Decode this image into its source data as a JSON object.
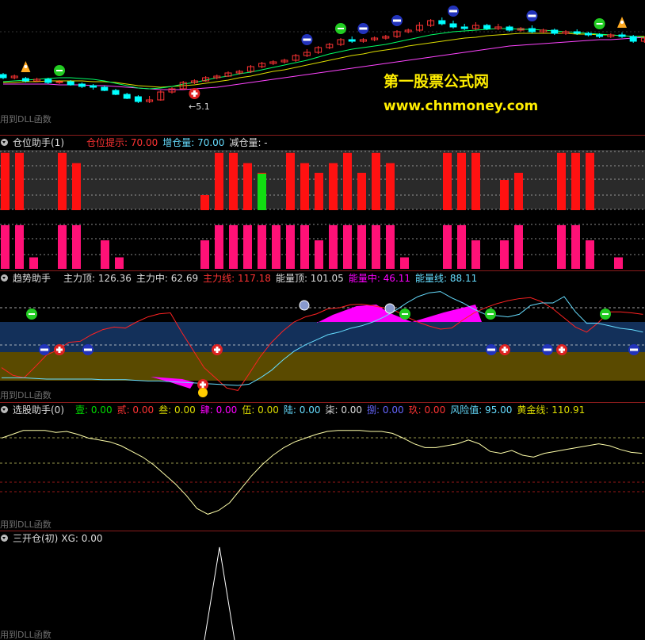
{
  "watermark": {
    "title": "第一股票公式网",
    "url": "www.chnmoney.com"
  },
  "main_panel": {
    "dll_note": "用到DLL函数",
    "low_label": "←5.1",
    "candles": [
      {
        "o": 94,
        "c": 98,
        "h": 92,
        "l": 100
      },
      {
        "o": 98,
        "c": 96,
        "h": 94,
        "l": 100
      },
      {
        "o": 99,
        "c": 102,
        "h": 97,
        "l": 104
      },
      {
        "o": 102,
        "c": 100,
        "h": 98,
        "l": 103
      },
      {
        "o": 100,
        "c": 104,
        "h": 98,
        "l": 106
      },
      {
        "o": 104,
        "c": 103,
        "h": 101,
        "l": 106
      },
      {
        "o": 103,
        "c": 107,
        "h": 101,
        "l": 108
      },
      {
        "o": 106,
        "c": 109,
        "h": 104,
        "l": 111
      },
      {
        "o": 108,
        "c": 110,
        "h": 106,
        "l": 113
      },
      {
        "o": 110,
        "c": 114,
        "h": 108,
        "l": 115
      },
      {
        "o": 114,
        "c": 119,
        "h": 112,
        "l": 120
      },
      {
        "o": 119,
        "c": 124,
        "h": 117,
        "l": 125
      },
      {
        "o": 122,
        "c": 128,
        "h": 120,
        "l": 130
      },
      {
        "o": 128,
        "c": 126,
        "h": 121,
        "l": 130
      },
      {
        "o": 126,
        "c": 116,
        "h": 114,
        "l": 127
      },
      {
        "o": 116,
        "c": 112,
        "h": 110,
        "l": 118
      },
      {
        "o": 112,
        "c": 104,
        "h": 102,
        "l": 113
      },
      {
        "o": 104,
        "c": 102,
        "h": 100,
        "l": 106
      },
      {
        "o": 102,
        "c": 98,
        "h": 96,
        "l": 103
      },
      {
        "o": 98,
        "c": 96,
        "h": 94,
        "l": 100
      },
      {
        "o": 96,
        "c": 92,
        "h": 90,
        "l": 97
      },
      {
        "o": 92,
        "c": 90,
        "h": 88,
        "l": 94
      },
      {
        "o": 90,
        "c": 84,
        "h": 82,
        "l": 92
      },
      {
        "o": 84,
        "c": 80,
        "h": 78,
        "l": 86
      },
      {
        "o": 80,
        "c": 78,
        "h": 76,
        "l": 82
      },
      {
        "o": 78,
        "c": 76,
        "h": 74,
        "l": 80
      },
      {
        "o": 76,
        "c": 70,
        "h": 68,
        "l": 78
      },
      {
        "o": 70,
        "c": 66,
        "h": 62,
        "l": 72
      },
      {
        "o": 66,
        "c": 60,
        "h": 58,
        "l": 68
      },
      {
        "o": 60,
        "c": 56,
        "h": 54,
        "l": 62
      },
      {
        "o": 56,
        "c": 50,
        "h": 48,
        "l": 58
      },
      {
        "o": 50,
        "c": 52,
        "h": 46,
        "l": 54
      },
      {
        "o": 52,
        "c": 50,
        "h": 48,
        "l": 54
      },
      {
        "o": 50,
        "c": 48,
        "h": 46,
        "l": 52
      },
      {
        "o": 48,
        "c": 46,
        "h": 44,
        "l": 50
      },
      {
        "o": 46,
        "c": 40,
        "h": 38,
        "l": 48
      },
      {
        "o": 40,
        "c": 38,
        "h": 36,
        "l": 42
      },
      {
        "o": 38,
        "c": 32,
        "h": 28,
        "l": 40
      },
      {
        "o": 32,
        "c": 26,
        "h": 24,
        "l": 34
      },
      {
        "o": 26,
        "c": 30,
        "h": 22,
        "l": 32
      },
      {
        "o": 30,
        "c": 34,
        "h": 26,
        "l": 36
      },
      {
        "o": 34,
        "c": 36,
        "h": 30,
        "l": 38
      },
      {
        "o": 36,
        "c": 32,
        "h": 28,
        "l": 38
      },
      {
        "o": 32,
        "c": 36,
        "h": 30,
        "l": 38
      },
      {
        "o": 36,
        "c": 34,
        "h": 30,
        "l": 38
      },
      {
        "o": 34,
        "c": 38,
        "h": 32,
        "l": 40
      },
      {
        "o": 38,
        "c": 36,
        "h": 34,
        "l": 40
      },
      {
        "o": 36,
        "c": 40,
        "h": 32,
        "l": 42
      },
      {
        "o": 40,
        "c": 38,
        "h": 36,
        "l": 42
      },
      {
        "o": 38,
        "c": 42,
        "h": 36,
        "l": 44
      },
      {
        "o": 42,
        "c": 40,
        "h": 38,
        "l": 44
      },
      {
        "o": 40,
        "c": 42,
        "h": 37,
        "l": 44
      },
      {
        "o": 42,
        "c": 44,
        "h": 40,
        "l": 46
      },
      {
        "o": 44,
        "c": 46,
        "h": 42,
        "l": 48
      },
      {
        "o": 46,
        "c": 44,
        "h": 42,
        "l": 48
      },
      {
        "o": 44,
        "c": 46,
        "h": 41,
        "l": 48
      },
      {
        "o": 46,
        "c": 52,
        "h": 44,
        "l": 54
      },
      {
        "o": 52,
        "c": 48,
        "h": 46,
        "l": 54
      }
    ],
    "ma_fast": [
      103,
      102,
      101,
      100,
      99,
      98,
      98,
      99,
      100,
      102,
      105,
      108,
      111,
      112,
      111,
      109,
      106,
      104,
      101,
      98,
      96,
      93,
      91,
      88,
      85,
      82,
      79,
      76,
      72,
      68,
      65,
      62,
      60,
      58,
      56,
      53,
      50,
      47,
      44,
      42,
      40,
      39,
      38,
      37,
      36,
      36,
      37,
      37,
      38,
      39,
      40,
      41,
      42,
      43,
      44,
      45,
      46,
      47
    ],
    "ma_mid": [
      104,
      104,
      103,
      103,
      102,
      102,
      102,
      102,
      103,
      103,
      104,
      106,
      108,
      109,
      110,
      109,
      108,
      107,
      105,
      103,
      101,
      98,
      96,
      93,
      90,
      88,
      85,
      82,
      79,
      76,
      73,
      70,
      68,
      65,
      63,
      61,
      58,
      56,
      54,
      52,
      50,
      48,
      47,
      45,
      44,
      43,
      42,
      42,
      42,
      42,
      42,
      43,
      43,
      44,
      44,
      45,
      46,
      46
    ],
    "ma_slow": [
      106,
      106,
      106,
      106,
      106,
      107,
      107,
      107,
      108,
      108,
      109,
      110,
      111,
      112,
      113,
      113,
      113,
      112,
      111,
      110,
      108,
      106,
      104,
      102,
      100,
      98,
      96,
      94,
      92,
      90,
      88,
      86,
      84,
      82,
      80,
      78,
      76,
      74,
      72,
      70,
      68,
      66,
      64,
      62,
      60,
      58,
      57,
      56,
      55,
      54,
      53,
      52,
      51,
      50,
      50,
      49,
      48,
      47
    ],
    "signals": [
      {
        "i": 2,
        "type": "rocket"
      },
      {
        "i": 5,
        "type": "green"
      },
      {
        "i": 17,
        "type": "plus"
      },
      {
        "i": 27,
        "type": "blue"
      },
      {
        "i": 30,
        "type": "green"
      },
      {
        "i": 32,
        "type": "blue"
      },
      {
        "i": 35,
        "type": "blue"
      },
      {
        "i": 40,
        "type": "blue"
      },
      {
        "i": 47,
        "type": "blue"
      },
      {
        "i": 53,
        "type": "green"
      },
      {
        "i": 55,
        "type": "rocket"
      }
    ]
  },
  "panel_cw": {
    "title": "仓位助手(1)",
    "items": [
      {
        "label": "仓位提示: 70.00",
        "color": "#ff3333"
      },
      {
        "label": "增仓量: 70.00",
        "color": "#66ddff"
      },
      {
        "label": "减仓量: -",
        "color": "#dddddd"
      }
    ],
    "top_bars": [
      0.95,
      0.95,
      0,
      0,
      0.95,
      0.78,
      0,
      0,
      0,
      0,
      0,
      0,
      0,
      0,
      0.25,
      0.95,
      0.95,
      0.78,
      0.62,
      0,
      0.95,
      0.78,
      0.62,
      0.78,
      0.95,
      0.62,
      0.95,
      0.78,
      0,
      0,
      0,
      0.95,
      0.95,
      0.95,
      0,
      0.5,
      0.62,
      0,
      0,
      0.95,
      0.95,
      0.95,
      0,
      0,
      0
    ],
    "bottom_bars": [
      0.95,
      0.95,
      0.25,
      0,
      0.95,
      0.95,
      0,
      0.62,
      0.25,
      0,
      0,
      0,
      0,
      0,
      0.62,
      0.95,
      0.95,
      0.95,
      0.95,
      0.95,
      0.95,
      0.95,
      0.62,
      0.95,
      0.95,
      0.95,
      0.95,
      0.95,
      0.25,
      0,
      0,
      0.95,
      0.95,
      0.62,
      0,
      0.62,
      0.95,
      0,
      0,
      0.95,
      0.95,
      0.62,
      0,
      0.25,
      0
    ]
  },
  "panel_qs": {
    "title": "趋势助手",
    "dll_note": "用到DLL函数",
    "items": [
      {
        "label": "主力顶: 126.36",
        "color": "#dddddd"
      },
      {
        "label": "主力中: 62.69",
        "color": "#dddddd"
      },
      {
        "label": "主力线: 117.18",
        "color": "#ff3333"
      },
      {
        "label": "能量顶: 101.05",
        "color": "#dddddd"
      },
      {
        "label": "能量中: 46.11",
        "color": "#ff00ff"
      },
      {
        "label": "能量线: 88.11",
        "color": "#66ddff"
      }
    ],
    "red_line": [
      60,
      45,
      40,
      62,
      85,
      95,
      110,
      112,
      125,
      135,
      140,
      138,
      150,
      160,
      166,
      168,
      130,
      95,
      60,
      40,
      20,
      15,
      48,
      82,
      110,
      132,
      150,
      160,
      166,
      176,
      178,
      184,
      185,
      182,
      178,
      172,
      160,
      150,
      142,
      136,
      138,
      154,
      168,
      178,
      186,
      192,
      196,
      198,
      190,
      176,
      158,
      140,
      130,
      148,
      170,
      170,
      168,
      165
    ],
    "cyan_line": [
      32,
      32,
      32,
      31,
      30,
      30,
      30,
      30,
      30,
      29,
      29,
      29,
      28,
      27,
      27,
      26,
      25,
      24,
      23,
      22,
      21,
      20,
      22,
      32,
      44,
      60,
      74,
      84,
      92,
      100,
      104,
      110,
      114,
      120,
      128,
      138,
      150,
      160,
      166,
      168,
      158,
      150,
      140,
      132,
      130,
      128,
      132,
      146,
      150,
      150,
      160,
      136,
      118,
      118,
      114,
      110,
      108,
      104
    ]
  },
  "panel_xg": {
    "title": "选股助手(0)",
    "dll_note": "用到DLL函数",
    "items": [
      {
        "label": "壹: 0.00",
        "color": "#00dd00"
      },
      {
        "label": "贰: 0.00",
        "color": "#ff3333"
      },
      {
        "label": "叁: 0.00",
        "color": "#dddd00"
      },
      {
        "label": "肆: 0.00",
        "color": "#ff00ff"
      },
      {
        "label": "伍: 0.00",
        "color": "#dddd00"
      },
      {
        "label": "陆: 0.00",
        "color": "#66ddff"
      },
      {
        "label": "柒: 0.00",
        "color": "#dddddd"
      },
      {
        "label": "捌: 0.00",
        "color": "#6666ff"
      },
      {
        "label": "玖: 0.00",
        "color": "#ff3333"
      },
      {
        "label": "风险值: 95.00",
        "color": "#66ddff"
      },
      {
        "label": "黄金线: 110.91",
        "color": "#dddd00"
      }
    ],
    "line": [
      88,
      92,
      96,
      96,
      96,
      94,
      95,
      92,
      88,
      86,
      84,
      80,
      74,
      68,
      60,
      50,
      40,
      28,
      14,
      8,
      12,
      20,
      34,
      48,
      60,
      70,
      78,
      84,
      88,
      92,
      95,
      96,
      96,
      96,
      95,
      95,
      93,
      88,
      82,
      78,
      78,
      80,
      82,
      86,
      82,
      74,
      72,
      75,
      70,
      68,
      72,
      74,
      76,
      78,
      80,
      82,
      80,
      76,
      73,
      72
    ]
  },
  "panel_sk": {
    "title": "三开仓(初)",
    "dll_note": "用到DLL函数",
    "items": [
      {
        "label": "XG: 0.00",
        "color": "#dddddd"
      }
    ]
  },
  "colors": {
    "up": "#ff3333",
    "down": "#00ffff",
    "separator": "#8a1c1c"
  }
}
